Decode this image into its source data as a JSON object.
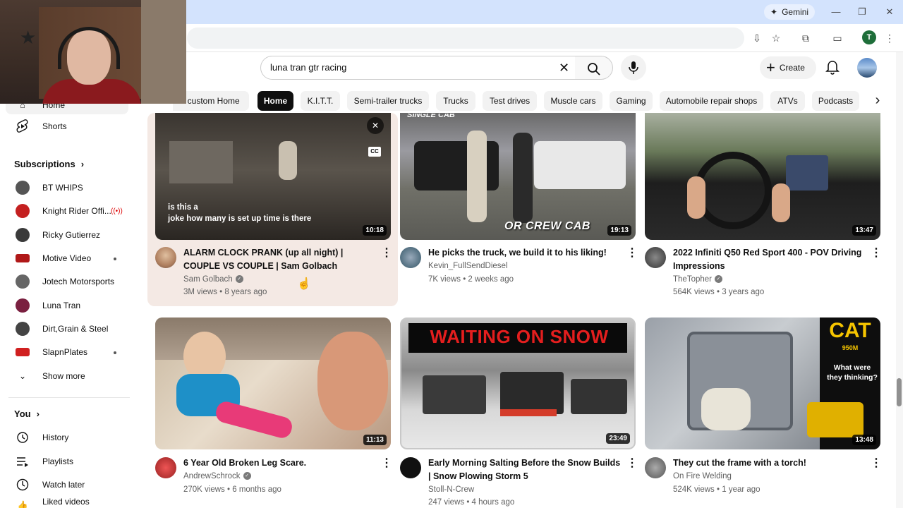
{
  "browser": {
    "gemini_label": "Gemini",
    "profile_initial": "T"
  },
  "header": {
    "search_value": "luna tran gtr racing",
    "create_label": "Create"
  },
  "chips": [
    {
      "label": "r custom Home",
      "active": false
    },
    {
      "label": "Home",
      "active": true
    },
    {
      "label": "K.I.T.T.",
      "active": false
    },
    {
      "label": "Semi-trailer trucks",
      "active": false
    },
    {
      "label": "Trucks",
      "active": false
    },
    {
      "label": "Test drives",
      "active": false
    },
    {
      "label": "Muscle cars",
      "active": false
    },
    {
      "label": "Gaming",
      "active": false
    },
    {
      "label": "Automobile repair shops",
      "active": false
    },
    {
      "label": "ATVs",
      "active": false
    },
    {
      "label": "Podcasts",
      "active": false
    }
  ],
  "sidebar": {
    "home_label": "Home",
    "shorts_label": "Shorts",
    "subscriptions_heading": "Subscriptions",
    "subscriptions": [
      {
        "label": "BT WHIPS",
        "color": "#555555",
        "indicator": ""
      },
      {
        "label": "Knight Rider Offi...",
        "color": "#c42020",
        "indicator": "live"
      },
      {
        "label": "Ricky Gutierrez",
        "color": "#3a3a3a",
        "indicator": ""
      },
      {
        "label": "Motive Video",
        "color": "#b01818",
        "indicator": "dot"
      },
      {
        "label": "Jotech Motorsports",
        "color": "#666666",
        "indicator": ""
      },
      {
        "label": "Luna Tran",
        "color": "#7a2040",
        "indicator": ""
      },
      {
        "label": "Dirt,Grain & Steel",
        "color": "#444444",
        "indicator": ""
      },
      {
        "label": "SlapnPlates",
        "color": "#d02020",
        "indicator": "dot"
      }
    ],
    "show_more_label": "Show more",
    "you_heading": "You",
    "you_items": [
      {
        "label": "History",
        "icon": "history-icon"
      },
      {
        "label": "Playlists",
        "icon": "playlists-icon"
      },
      {
        "label": "Watch later",
        "icon": "watch-later-icon"
      },
      {
        "label": "Liked videos",
        "icon": "liked-videos-icon"
      }
    ]
  },
  "videos": [
    {
      "title_line1": "ALARM CLOCK PRANK (up all night) |",
      "title_line2": "COUPLE VS COUPLE | Sam Golbach",
      "channel": "Sam Golbach",
      "verified": true,
      "meta": "3M views • 8 years ago",
      "duration": "10:18",
      "caption_line1": "is this a",
      "caption_line2": "joke how many is set up time is there",
      "cc_label": "CC"
    },
    {
      "title_line1": "He picks the truck, we build it to his liking!",
      "title_line2": "",
      "channel": "Kevin_FullSendDiesel",
      "verified": false,
      "meta": "7K views • 2 weeks ago",
      "duration": "19:13",
      "overlay_text": "OR CREW CAB",
      "overlay_top": "SINGLE CAB"
    },
    {
      "title_line1": "2022 Infiniti Q50 Red Sport 400 - POV Driving",
      "title_line2": "Impressions",
      "channel": "TheTopher",
      "verified": true,
      "meta": "564K views • 3 years ago",
      "duration": "13:47"
    },
    {
      "title_line1": "6 Year Old Broken Leg Scare.",
      "title_line2": "",
      "channel": "AndrewSchrock",
      "verified": true,
      "meta": "270K views • 6 months ago",
      "duration": "11:13"
    },
    {
      "title_line1": "Early Morning Salting Before the Snow Builds",
      "title_line2": "| Snow Plowing Storm 5",
      "channel": "Stoll-N-Crew",
      "verified": false,
      "meta": "247 views • 4 hours ago",
      "duration": "23:49",
      "overlay_text": "WAITING ON SNOW"
    },
    {
      "title_line1": "They cut the frame with a torch!",
      "title_line2": "",
      "channel": "On Fire Welding",
      "verified": false,
      "meta": "524K views • 1 year ago",
      "duration": "13:48",
      "overlay_brand": "CAT",
      "overlay_model": "950M",
      "overlay_question": "What were they thinking?"
    }
  ]
}
